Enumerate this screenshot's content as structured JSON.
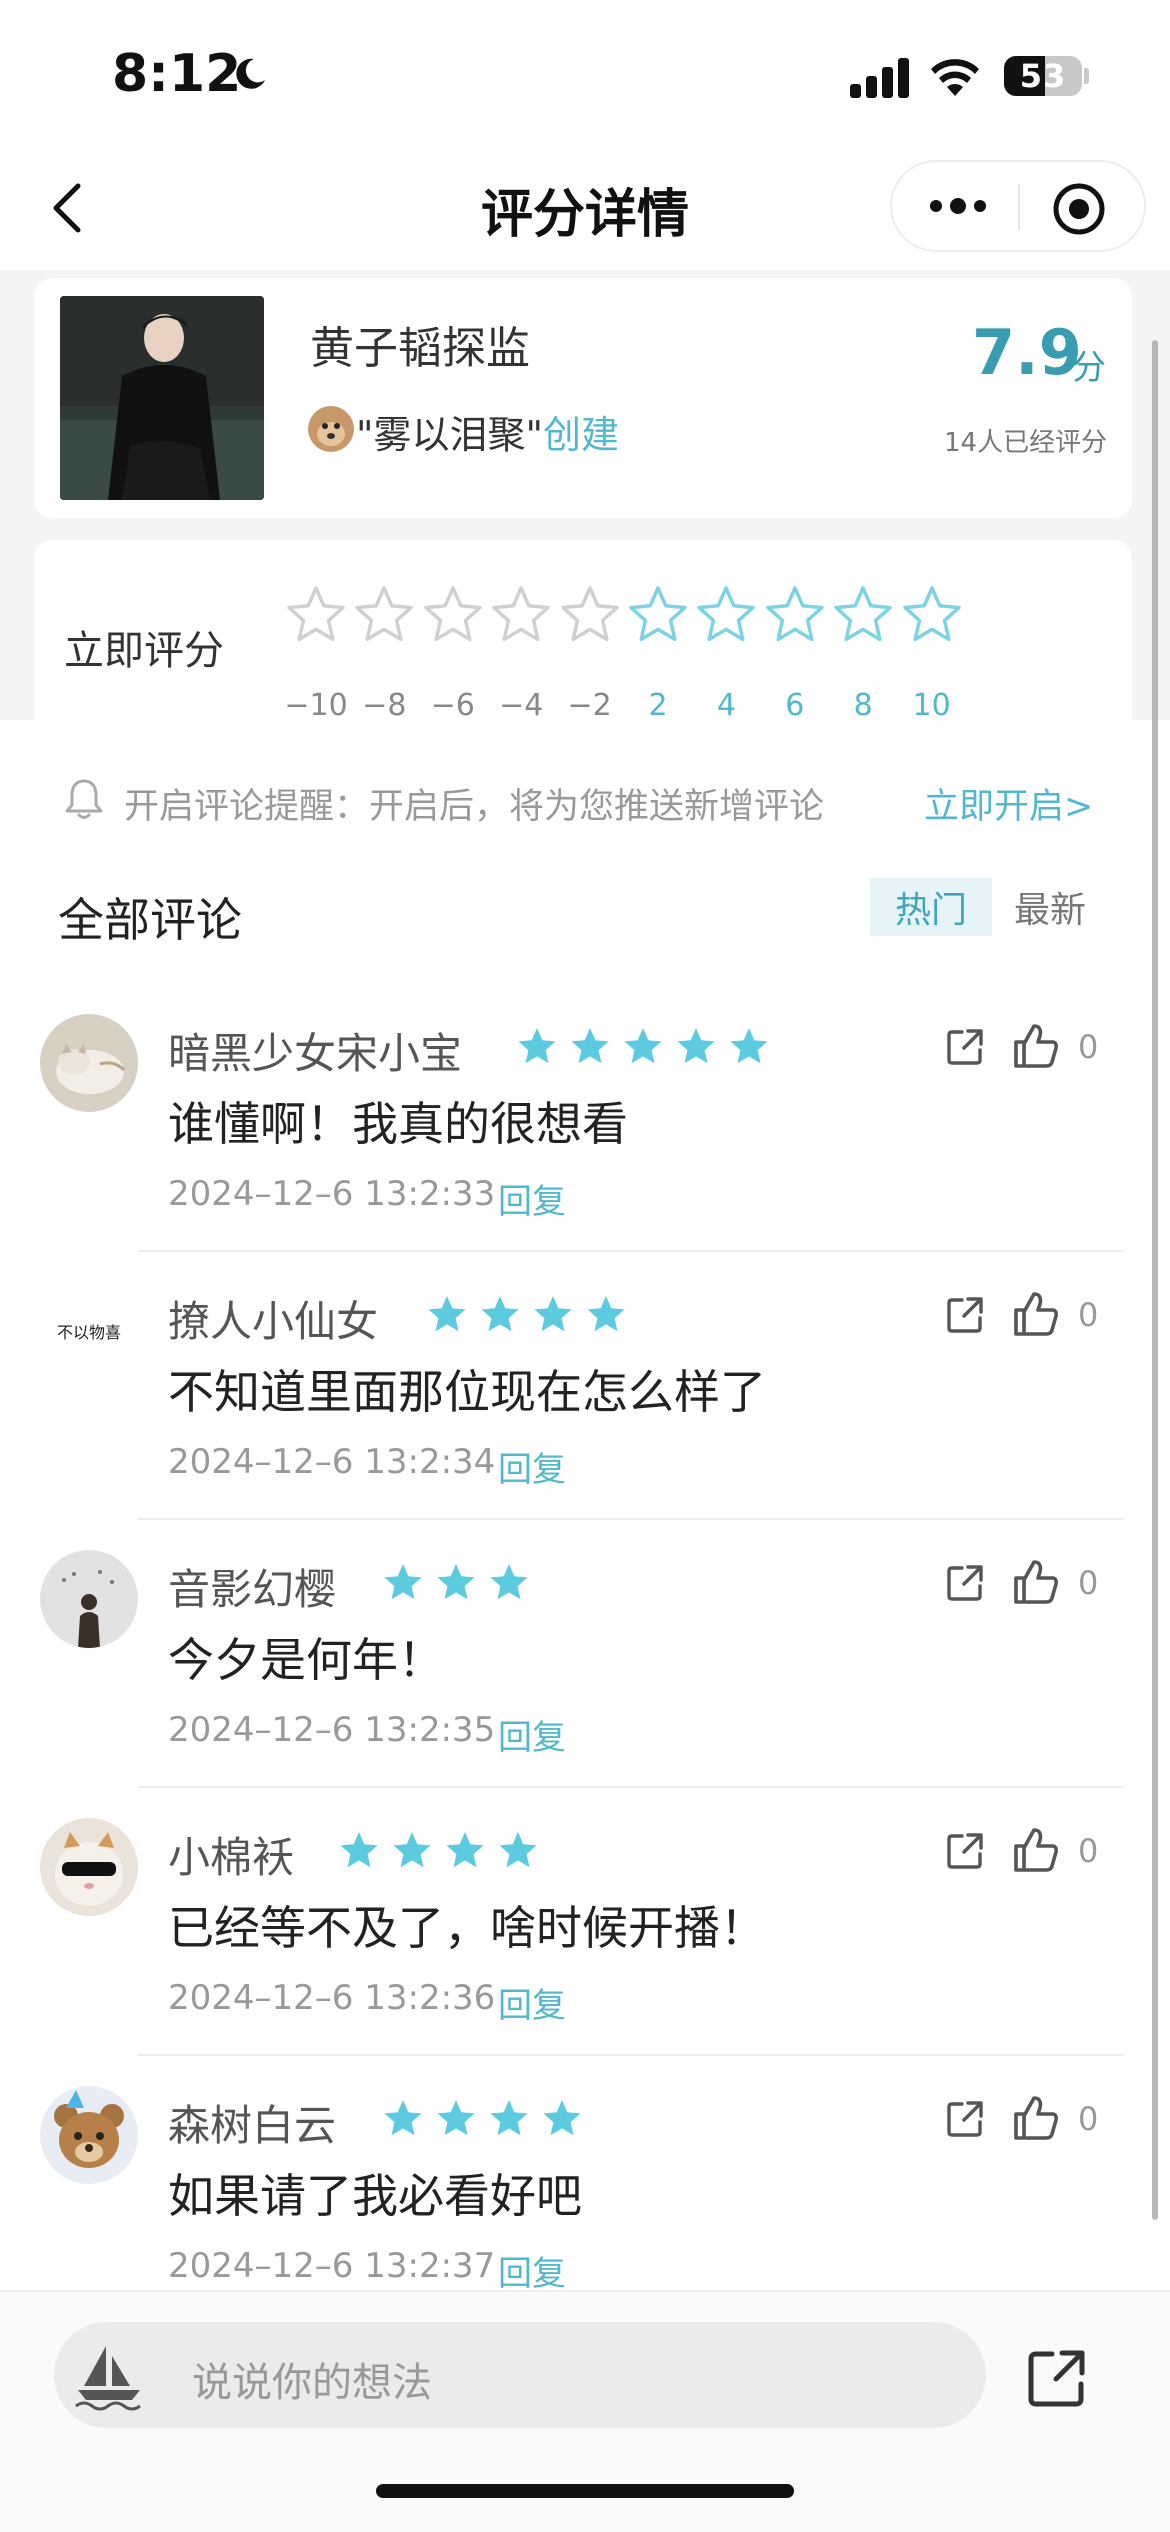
{
  "status_bar": {
    "time": "8:12",
    "battery": "53"
  },
  "nav": {
    "title": "评分详情"
  },
  "show": {
    "title": "黄子韬探监",
    "creator_prefix": "\"雾以泪聚\"",
    "creator_suffix": "创建",
    "score": "7.9",
    "score_unit": "分",
    "rated_count": "14人已经评分"
  },
  "rating": {
    "label": "立即评分",
    "scale": [
      "−10",
      "−8",
      "−6",
      "−4",
      "−2",
      "2",
      "4",
      "6",
      "8",
      "10"
    ]
  },
  "reminder": {
    "text": "开启评论提醒：开启后，将为您推送新增评论",
    "link": "立即开启>"
  },
  "comments_section": {
    "title": "全部评论",
    "tab_hot": "热门",
    "tab_new": "最新"
  },
  "comments": [
    {
      "name": "暗黑少女宋小宝",
      "stars": 5,
      "text": "谁懂啊！我真的很想看",
      "time": "2024–12–6 13:2:33",
      "reply": "回复",
      "likes": "0"
    },
    {
      "name": "撩人小仙女",
      "stars": 4,
      "text": "不知道里面那位现在怎么样了",
      "time": "2024–12–6 13:2:34",
      "reply": "回复",
      "likes": "0"
    },
    {
      "name": "音影幻樱",
      "stars": 3,
      "text": "今夕是何年！",
      "time": "2024–12–6 13:2:35",
      "reply": "回复",
      "likes": "0"
    },
    {
      "name": "小棉袄",
      "stars": 4,
      "text": "已经等不及了，啥时候开播！",
      "time": "2024–12–6 13:2:36",
      "reply": "回复",
      "likes": "0"
    },
    {
      "name": "森树白云",
      "stars": 4,
      "text": "如果请了我必看好吧",
      "time": "2024–12–6 13:2:37",
      "reply": "回复",
      "likes": "0"
    }
  ],
  "avatar2_text": "不以物喜",
  "bottom": {
    "placeholder": "说说你的想法"
  },
  "colors": {
    "accent": "#52b8cc",
    "score": "#3a9cb0",
    "star_fill": "#5ccbe0"
  }
}
